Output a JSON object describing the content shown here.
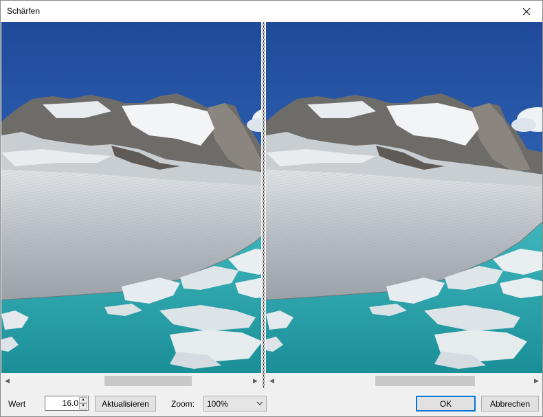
{
  "window": {
    "title": "Schärfen",
    "close_icon": "close-icon"
  },
  "controls": {
    "value_label": "Wert",
    "value": "16.0",
    "refresh_button": "Aktualisieren",
    "zoom_label": "Zoom:",
    "zoom_value": "100%",
    "ok_button": "OK",
    "cancel_button": "Abbrechen"
  },
  "preview": {
    "left": "original-preview",
    "right": "sharpened-preview"
  },
  "colors": {
    "default_button_border": "#0078d7",
    "sky": "#2c5aa6",
    "water": "#2aa8b0"
  }
}
